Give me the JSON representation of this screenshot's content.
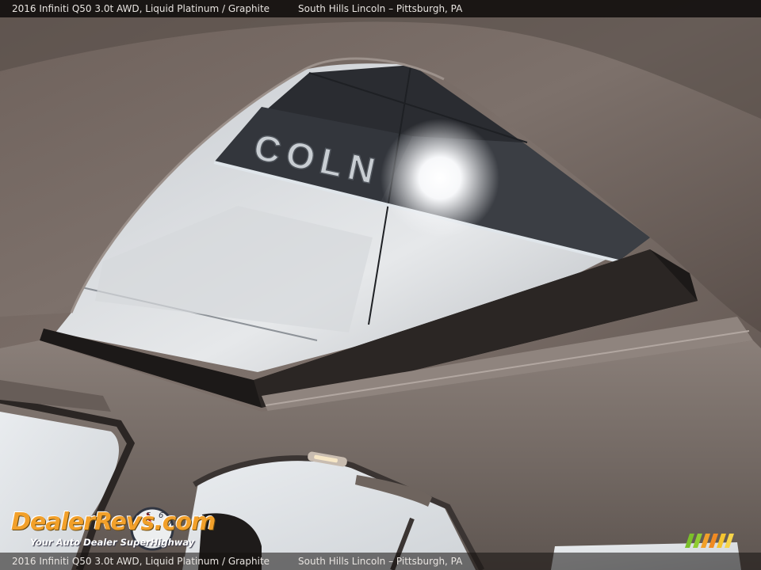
{
  "caption": {
    "vehicle": "2016 Infiniti Q50 3.0t AWD,  Liquid Platinum / Graphite",
    "dealer": "South Hills Lincoln – Pittsburgh, PA"
  },
  "photo": {
    "subject": "sunroof-interior-view",
    "building_sign_text": "COLN"
  },
  "watermark": {
    "brand_text": "DealerRevs.com",
    "tagline": "Your Auto Dealer SuperHighway",
    "colors": {
      "brand": "#f2a02a",
      "tagline": "#ffffff"
    }
  }
}
